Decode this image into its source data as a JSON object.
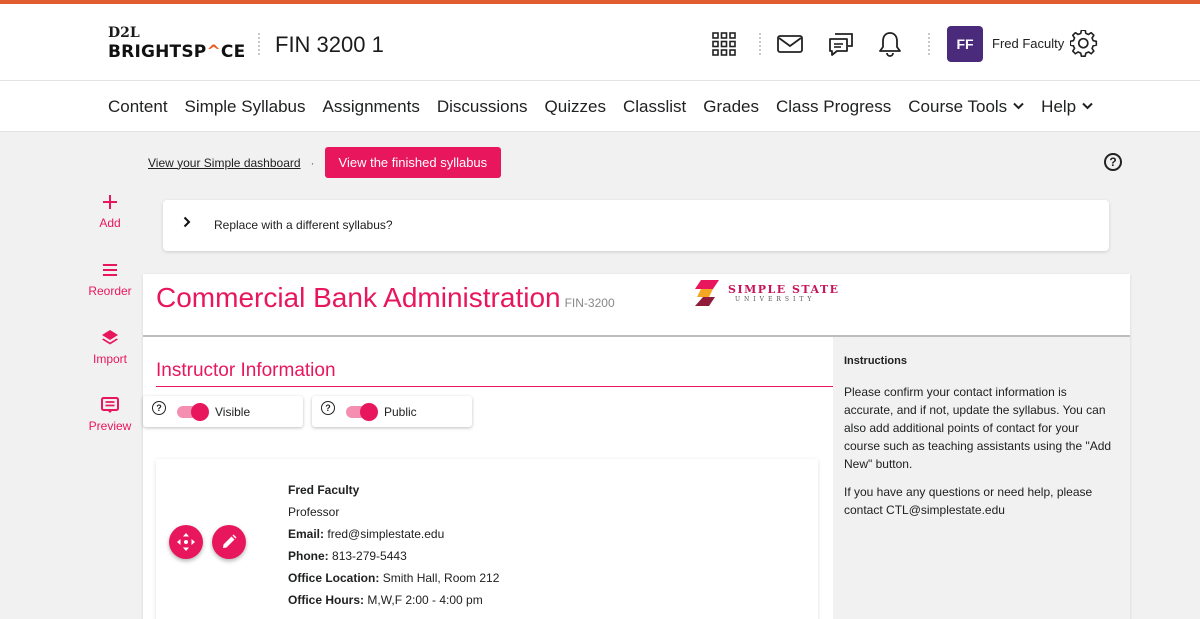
{
  "header": {
    "logo_top": "D2L",
    "logo_bottom_pre": "BRIGHTSP",
    "logo_bottom_lambda": "^",
    "logo_bottom_post": "CE",
    "course_title": "FIN 3200 1",
    "user_initials": "FF",
    "user_name": "Fred Faculty",
    "icons": [
      "app-grid-icon",
      "mail-icon",
      "chat-icon",
      "bell-icon",
      "gear-icon"
    ],
    "accent_color": "#e15c2e"
  },
  "nav": {
    "items": [
      "Content",
      "Simple Syllabus",
      "Assignments",
      "Discussions",
      "Quizzes",
      "Classlist",
      "Grades",
      "Class Progress",
      "Course Tools",
      "Help"
    ]
  },
  "topbar": {
    "dashboard_link": "View your Simple dashboard",
    "separator": "·",
    "finished_button": "View the finished syllabus",
    "help_glyph": "?"
  },
  "sidebar": {
    "items": [
      {
        "label": "Add",
        "icon": "plus-icon"
      },
      {
        "label": "Reorder",
        "icon": "reorder-icon"
      },
      {
        "label": "Import",
        "icon": "layers-icon"
      },
      {
        "label": "Preview",
        "icon": "preview-icon"
      }
    ]
  },
  "replace": {
    "label": "Replace with a different syllabus?"
  },
  "syllabus": {
    "course_name": "Commercial Bank Administration",
    "course_code": "FIN-3200",
    "university_name": "SIMPLE STATE",
    "university_sub": "UNIVERSITY",
    "brand_color": "#e8175d"
  },
  "section": {
    "title": "Instructor Information",
    "toggle_visible": "Visible",
    "toggle_public": "Public"
  },
  "instructor": {
    "name": "Fred Faculty",
    "role": "Professor",
    "email_label": "Email:",
    "email": "fred@simplestate.edu",
    "phone_label": "Phone:",
    "phone": "813-279-5443",
    "office_label": "Office Location:",
    "office": "Smith Hall, Room 212",
    "hours_label": "Office Hours:",
    "hours": "M,W,F 2:00 - 4:00 pm"
  },
  "instructions": {
    "title": "Instructions",
    "p1": "Please confirm your contact information is accurate, and if not, update the syllabus. You can also add additional points of contact for your course such as teaching assistants using the \"Add New\" button.",
    "p2": "If you have any questions or need help, please contact CTL@simplestate.edu"
  }
}
